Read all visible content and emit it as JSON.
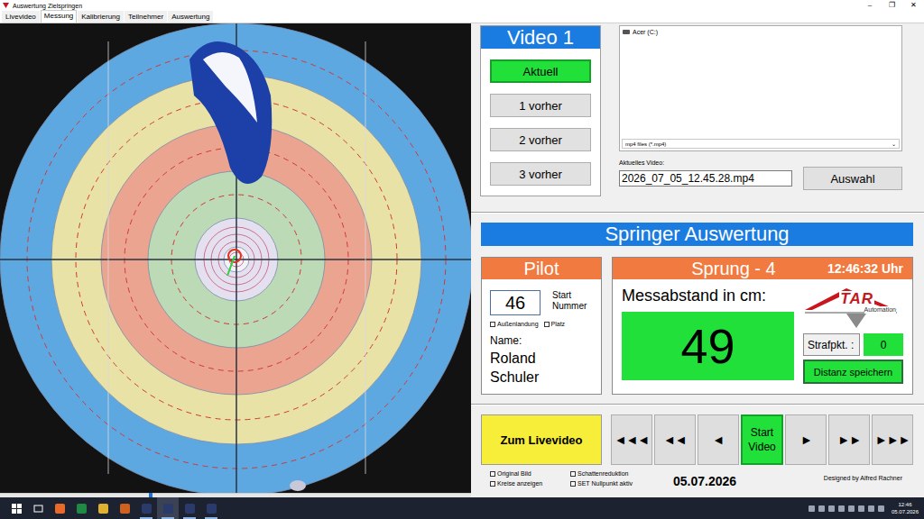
{
  "window": {
    "title": "Auswertung Zielspringen",
    "controls": [
      "–",
      "❐",
      "✕"
    ]
  },
  "tabs": [
    {
      "label": "Livevideo",
      "selected": false
    },
    {
      "label": "Messung",
      "selected": true
    },
    {
      "label": "Kalibrierung",
      "selected": false
    },
    {
      "label": "Teilnehmer",
      "selected": false
    },
    {
      "label": "Auswertung",
      "selected": false
    }
  ],
  "video_panel": {
    "title": "Video 1",
    "buttons": [
      {
        "label": "Aktuell",
        "selected": true
      },
      {
        "label": "1 vorher",
        "selected": false
      },
      {
        "label": "2 vorher",
        "selected": false
      },
      {
        "label": "3 vorher",
        "selected": false
      }
    ]
  },
  "file_browser": {
    "items": [
      {
        "label": "Acer (C:)"
      }
    ],
    "filter": "mp4 files (*.mp4)",
    "filter_arrow": "⌄",
    "current_label": "Aktuelles Video:",
    "current_value": "2026_07_05_12.45.28.mp4",
    "select_button": "Auswahl"
  },
  "section_title": "Springer Auswertung",
  "pilot": {
    "title": "Pilot",
    "start_number": "46",
    "start_number_label": "Start Nummer",
    "checkboxes": [
      {
        "label": "Außenlandung",
        "checked": false
      },
      {
        "label": "Platz",
        "checked": false
      }
    ],
    "name_label": "Name:",
    "name_lines": [
      "Roland",
      "Schuler"
    ]
  },
  "jump": {
    "title": "Sprung - 4",
    "time": "12:46:32 Uhr",
    "distance_label": "Messabstand in cm:",
    "distance": "49",
    "logo": {
      "text": "TAR",
      "subtext": "Automation"
    },
    "penalty_label": "Strafpkt. :",
    "penalty": "0",
    "save_button": "Distanz speichern"
  },
  "live_button": "Zum Livevideo",
  "nav_buttons": [
    {
      "label": "◄◄◄",
      "selected": false
    },
    {
      "label": "◄◄",
      "selected": false
    },
    {
      "label": "◄",
      "selected": false
    },
    {
      "label": "Start Video",
      "selected": true
    },
    {
      "label": "►",
      "selected": false
    },
    {
      "label": "►►",
      "selected": false
    },
    {
      "label": "►►►",
      "selected": false
    }
  ],
  "options": [
    {
      "label": "Original Bild",
      "checked": false
    },
    {
      "label": "Schattenreduktion",
      "checked": false
    },
    {
      "label": "Kreise anzeigen",
      "checked": false
    },
    {
      "label": "SET Nullpunkt aktiv",
      "checked": false
    }
  ],
  "date": "05.07.2026",
  "credit": "Designed by Alfred Rachner",
  "video_slider": {
    "level": 0.32
  },
  "taskbar": {
    "apps": [
      {
        "running": false,
        "active": false,
        "color": "#e8692a"
      },
      {
        "running": false,
        "active": false,
        "color": "#1e8a44"
      },
      {
        "running": false,
        "active": false,
        "color": "#e0b030"
      },
      {
        "running": false,
        "active": false,
        "color": "#d06020"
      },
      {
        "running": true,
        "active": false,
        "color": "#2a3a6a"
      },
      {
        "running": true,
        "active": true,
        "color": "#2a3a6a"
      },
      {
        "running": true,
        "active": false,
        "color": "#2a3a6a"
      },
      {
        "running": true,
        "active": false,
        "color": "#2a3a6a"
      }
    ],
    "clock": {
      "time": "12:46",
      "date": "05.07.2026"
    }
  }
}
